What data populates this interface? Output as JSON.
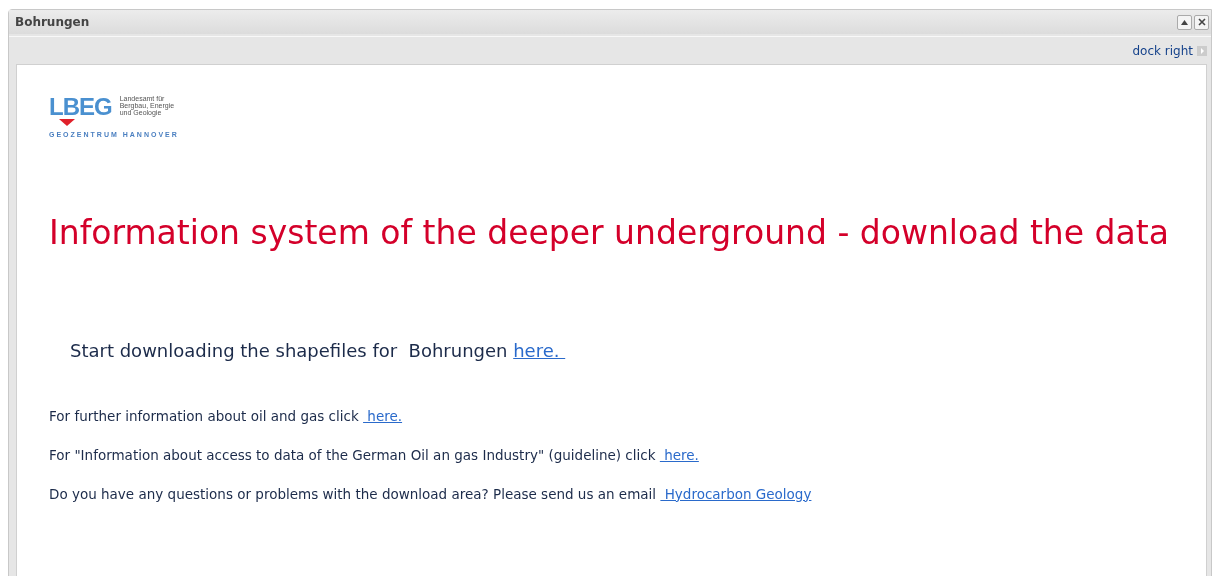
{
  "window": {
    "title": "Bohrungen"
  },
  "toolbar": {
    "dock_link": "dock right"
  },
  "logo": {
    "letters": "LBEG",
    "subtitle_lines": [
      "Landesamt für",
      "Bergbau, Energie",
      "und Geologie"
    ],
    "tagline": "GEOZENTRUM HANNOVER"
  },
  "heading": "Information system of the deeper underground - download the data",
  "download_line": {
    "text": "Start downloading the shapefiles for  Bohrungen ",
    "link": "here. "
  },
  "info_lines": [
    {
      "text": "For further information about oil and gas click ",
      "link": " here."
    },
    {
      "text": "For \"Information about access to data of the German Oil an gas Industry\" (guideline) click ",
      "link": " here."
    },
    {
      "text": "Do you have any questions or problems with the download area? Please send us an email ",
      "link": " Hydrocarbon Geology"
    }
  ]
}
